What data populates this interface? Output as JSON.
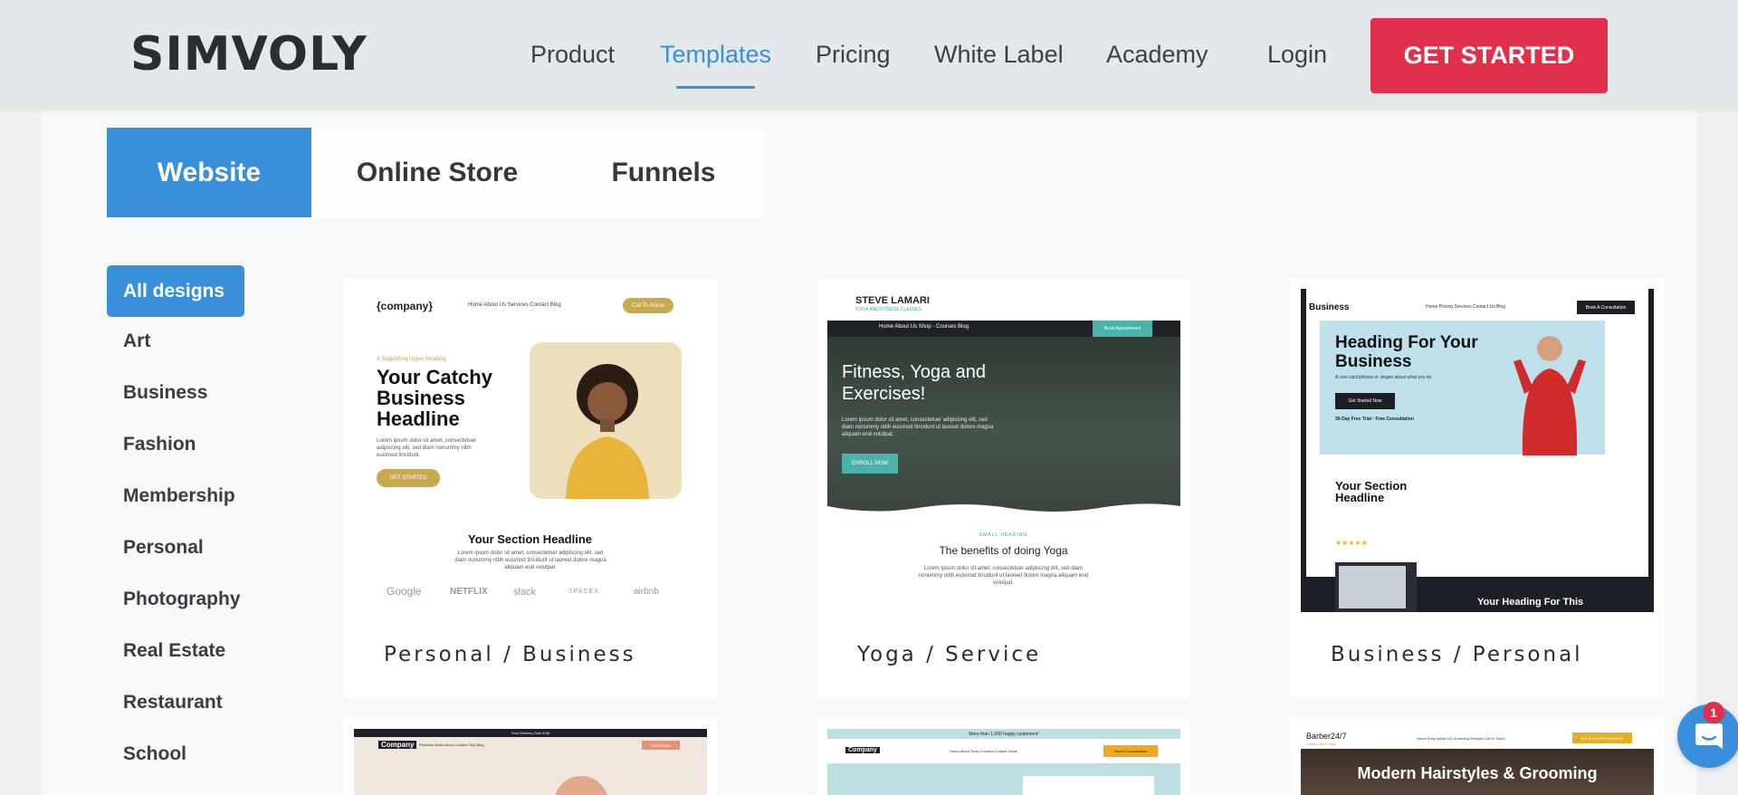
{
  "header": {
    "logo": "SIMVOLY",
    "nav": [
      "Product",
      "Templates",
      "Pricing",
      "White Label",
      "Academy"
    ],
    "login": "Login",
    "cta": "GET STARTED"
  },
  "tabs": [
    "Website",
    "Online Store",
    "Funnels"
  ],
  "categories": {
    "all": "All designs",
    "items": [
      "Art",
      "Business",
      "Fashion",
      "Membership",
      "Personal",
      "Photography",
      "Real Estate",
      "Restaurant",
      "School"
    ]
  },
  "cards": [
    {
      "caption": "Personal / Business",
      "brand": "{company}",
      "nav": "Home   About Us   Services   Contact   Blog",
      "cta": "Call To Action",
      "eyebrow": "A Supporting Upper Heading",
      "headline": "Your Catchy Business Headline",
      "body": "Lorem ipsum dolor sit amet, consectetuer adipiscing elit, sed diam nonummy nibh euismod tincidunt.",
      "button": "GET STARTED",
      "section": "Your Section Headline",
      "section_body": "Lorem ipsum dolor sit amet, consectetuer adipiscing elit, sed diam nonummy nibh euismod tincidunt ut laoreet dolore magna aliquam erat volutpat.",
      "logos": [
        "Google",
        "NETFLIX",
        "slack",
        "SPACEX",
        "airbnb"
      ]
    },
    {
      "caption": "Yoga / Service",
      "brand": "STEVE LAMARI",
      "tagline": "YOGA AND FITNESS CLASSES",
      "nav": "Home   About Us   Shop - Courses   Blog",
      "cta": "Book Appointment",
      "headline": "Fitness, Yoga and Exercises!",
      "body": "Lorem ipsum dolor sit amet, consectetuer adipiscing elit, sed diam nonummy nibh euismod tincidunt ut laoreet dolore magna aliquam erat volutpat.",
      "button": "ENROLL NOW",
      "small": "SMALL HEADING",
      "section": "The benefits of doing Yoga",
      "section_body": "Lorem ipsum dolor sit amet, consectetuer adipiscing elit, sed diam nonummy nibh euismod tincidunt ut laoreet dolore magna aliquam erat volutpat."
    },
    {
      "caption": "Business / Personal",
      "brand": "Business",
      "nav": "Home   Pricing   Services   Contact Us   Blog",
      "cta": "Book A Consultation",
      "headline": "Heading For Your Business",
      "sub": "A cool catchphrase or slogan about what you do",
      "button": "Get Started Now",
      "perks": "30-Day Free Trial  ·  Free Consultation",
      "section": "Your Section Headline",
      "banner": "Your Heading For This"
    },
    {
      "topbar": "Free Delivery Over $ 80",
      "brand": "Company",
      "nav": "Products   Deals   About   Contact   FAQ   Blog",
      "cta": "SHOP NOW"
    },
    {
      "topbar": "More than 1,000 happy customers!",
      "brand": "Company",
      "nav": "Home   About   Tools   Courses   Contact   Deals",
      "cta": "Book A Consultation"
    },
    {
      "brand": "Barber24/7",
      "tagline": "Great Cuts & Style",
      "nav": "Home   Shop   About US   Grooming Services   Get in Touch",
      "cta": "BOOK AN APPOINTMENT",
      "headline": "Modern Hairstyles & Grooming"
    }
  ],
  "chat": {
    "badge": "1"
  }
}
